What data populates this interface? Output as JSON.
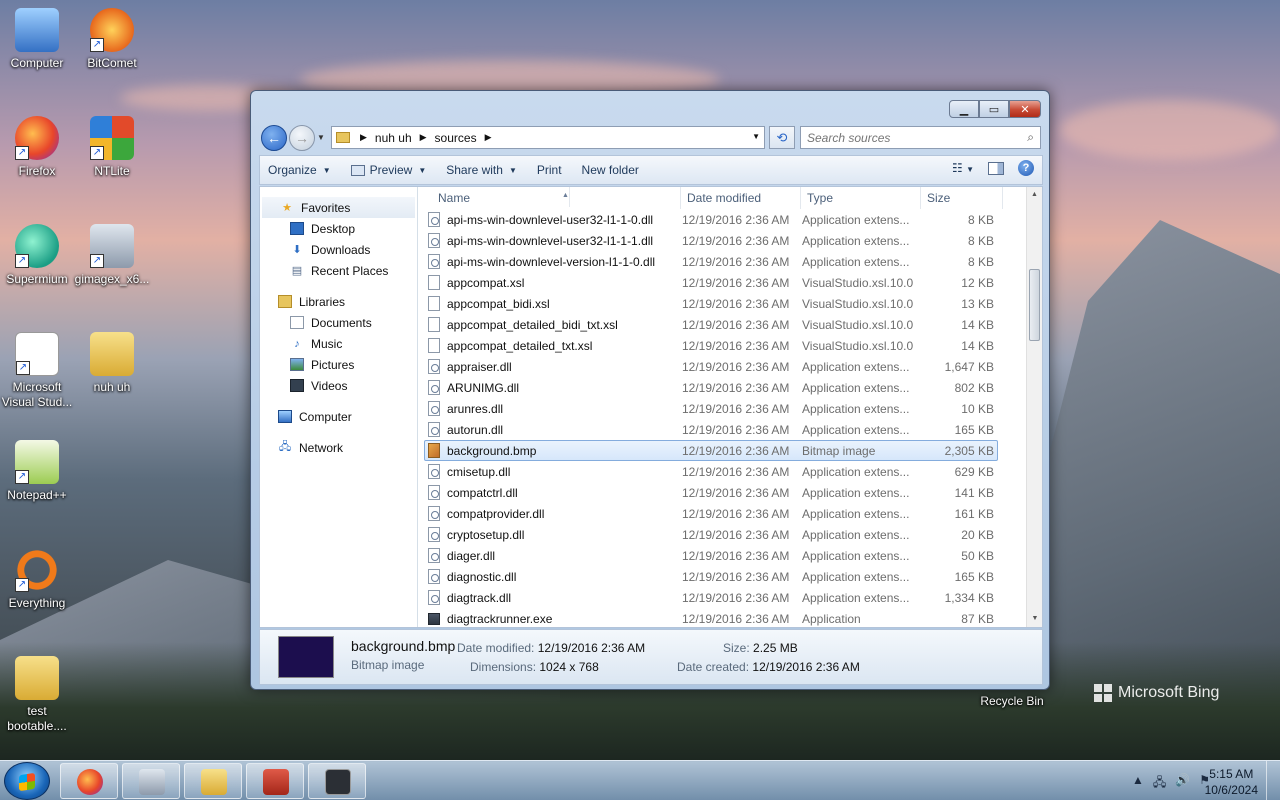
{
  "desktop": {
    "icons": [
      {
        "label": "Computer"
      },
      {
        "label": "BitComet"
      },
      {
        "label": "Firefox"
      },
      {
        "label": "NTLite"
      },
      {
        "label": "Supermium"
      },
      {
        "label": "gimagex_x6..."
      },
      {
        "label": "Microsoft Visual Stud..."
      },
      {
        "label": "nuh uh"
      },
      {
        "label": "Notepad++"
      },
      {
        "label": "Everything"
      },
      {
        "label": "test bootable...."
      },
      {
        "label": "Recycle Bin"
      }
    ],
    "watermark": "Microsoft Bing"
  },
  "window": {
    "address": {
      "crumbs": [
        "nuh uh",
        "sources"
      ]
    },
    "search_placeholder": "Search sources",
    "toolbar": {
      "organize": "Organize",
      "preview": "Preview",
      "share_with": "Share with",
      "print": "Print",
      "new_folder": "New folder"
    },
    "nav": {
      "favorites": "Favorites",
      "desktop": "Desktop",
      "downloads": "Downloads",
      "recent_places": "Recent Places",
      "libraries": "Libraries",
      "documents": "Documents",
      "music": "Music",
      "pictures": "Pictures",
      "videos": "Videos",
      "computer": "Computer",
      "network": "Network"
    },
    "columns": {
      "name": "Name",
      "date": "Date modified",
      "type": "Type",
      "size": "Size"
    },
    "files": [
      {
        "name": "api-ms-win-downlevel-user32-l1-1-0.dll",
        "date": "12/19/2016 2:36 AM",
        "type": "Application extens...",
        "size": "8 KB",
        "icon": "dll"
      },
      {
        "name": "api-ms-win-downlevel-user32-l1-1-1.dll",
        "date": "12/19/2016 2:36 AM",
        "type": "Application extens...",
        "size": "8 KB",
        "icon": "dll"
      },
      {
        "name": "api-ms-win-downlevel-version-l1-1-0.dll",
        "date": "12/19/2016 2:36 AM",
        "type": "Application extens...",
        "size": "8 KB",
        "icon": "dll"
      },
      {
        "name": "appcompat.xsl",
        "date": "12/19/2016 2:36 AM",
        "type": "VisualStudio.xsl.10.0",
        "size": "12 KB",
        "icon": "doc"
      },
      {
        "name": "appcompat_bidi.xsl",
        "date": "12/19/2016 2:36 AM",
        "type": "VisualStudio.xsl.10.0",
        "size": "13 KB",
        "icon": "doc"
      },
      {
        "name": "appcompat_detailed_bidi_txt.xsl",
        "date": "12/19/2016 2:36 AM",
        "type": "VisualStudio.xsl.10.0",
        "size": "14 KB",
        "icon": "doc"
      },
      {
        "name": "appcompat_detailed_txt.xsl",
        "date": "12/19/2016 2:36 AM",
        "type": "VisualStudio.xsl.10.0",
        "size": "14 KB",
        "icon": "doc"
      },
      {
        "name": "appraiser.dll",
        "date": "12/19/2016 2:36 AM",
        "type": "Application extens...",
        "size": "1,647 KB",
        "icon": "dll"
      },
      {
        "name": "ARUNIMG.dll",
        "date": "12/19/2016 2:36 AM",
        "type": "Application extens...",
        "size": "802 KB",
        "icon": "dll"
      },
      {
        "name": "arunres.dll",
        "date": "12/19/2016 2:36 AM",
        "type": "Application extens...",
        "size": "10 KB",
        "icon": "dll"
      },
      {
        "name": "autorun.dll",
        "date": "12/19/2016 2:36 AM",
        "type": "Application extens...",
        "size": "165 KB",
        "icon": "dll"
      },
      {
        "name": "background.bmp",
        "date": "12/19/2016 2:36 AM",
        "type": "Bitmap image",
        "size": "2,305 KB",
        "icon": "bmp",
        "selected": true
      },
      {
        "name": "cmisetup.dll",
        "date": "12/19/2016 2:36 AM",
        "type": "Application extens...",
        "size": "629 KB",
        "icon": "dll"
      },
      {
        "name": "compatctrl.dll",
        "date": "12/19/2016 2:36 AM",
        "type": "Application extens...",
        "size": "141 KB",
        "icon": "dll"
      },
      {
        "name": "compatprovider.dll",
        "date": "12/19/2016 2:36 AM",
        "type": "Application extens...",
        "size": "161 KB",
        "icon": "dll"
      },
      {
        "name": "cryptosetup.dll",
        "date": "12/19/2016 2:36 AM",
        "type": "Application extens...",
        "size": "20 KB",
        "icon": "dll"
      },
      {
        "name": "diager.dll",
        "date": "12/19/2016 2:36 AM",
        "type": "Application extens...",
        "size": "50 KB",
        "icon": "dll"
      },
      {
        "name": "diagnostic.dll",
        "date": "12/19/2016 2:36 AM",
        "type": "Application extens...",
        "size": "165 KB",
        "icon": "dll"
      },
      {
        "name": "diagtrack.dll",
        "date": "12/19/2016 2:36 AM",
        "type": "Application extens...",
        "size": "1,334 KB",
        "icon": "dll"
      },
      {
        "name": "diagtrackrunner.exe",
        "date": "12/19/2016 2:36 AM",
        "type": "Application",
        "size": "87 KB",
        "icon": "exe"
      }
    ],
    "details": {
      "name": "background.bmp",
      "type": "Bitmap image",
      "date_modified_label": "Date modified:",
      "date_modified": "12/19/2016 2:36 AM",
      "dimensions_label": "Dimensions:",
      "dimensions": "1024 x 768",
      "size_label": "Size:",
      "size": "2.25 MB",
      "date_created_label": "Date created:",
      "date_created": "12/19/2016 2:36 AM"
    }
  },
  "taskbar": {
    "time": "5:15 AM",
    "date": "10/6/2024"
  }
}
